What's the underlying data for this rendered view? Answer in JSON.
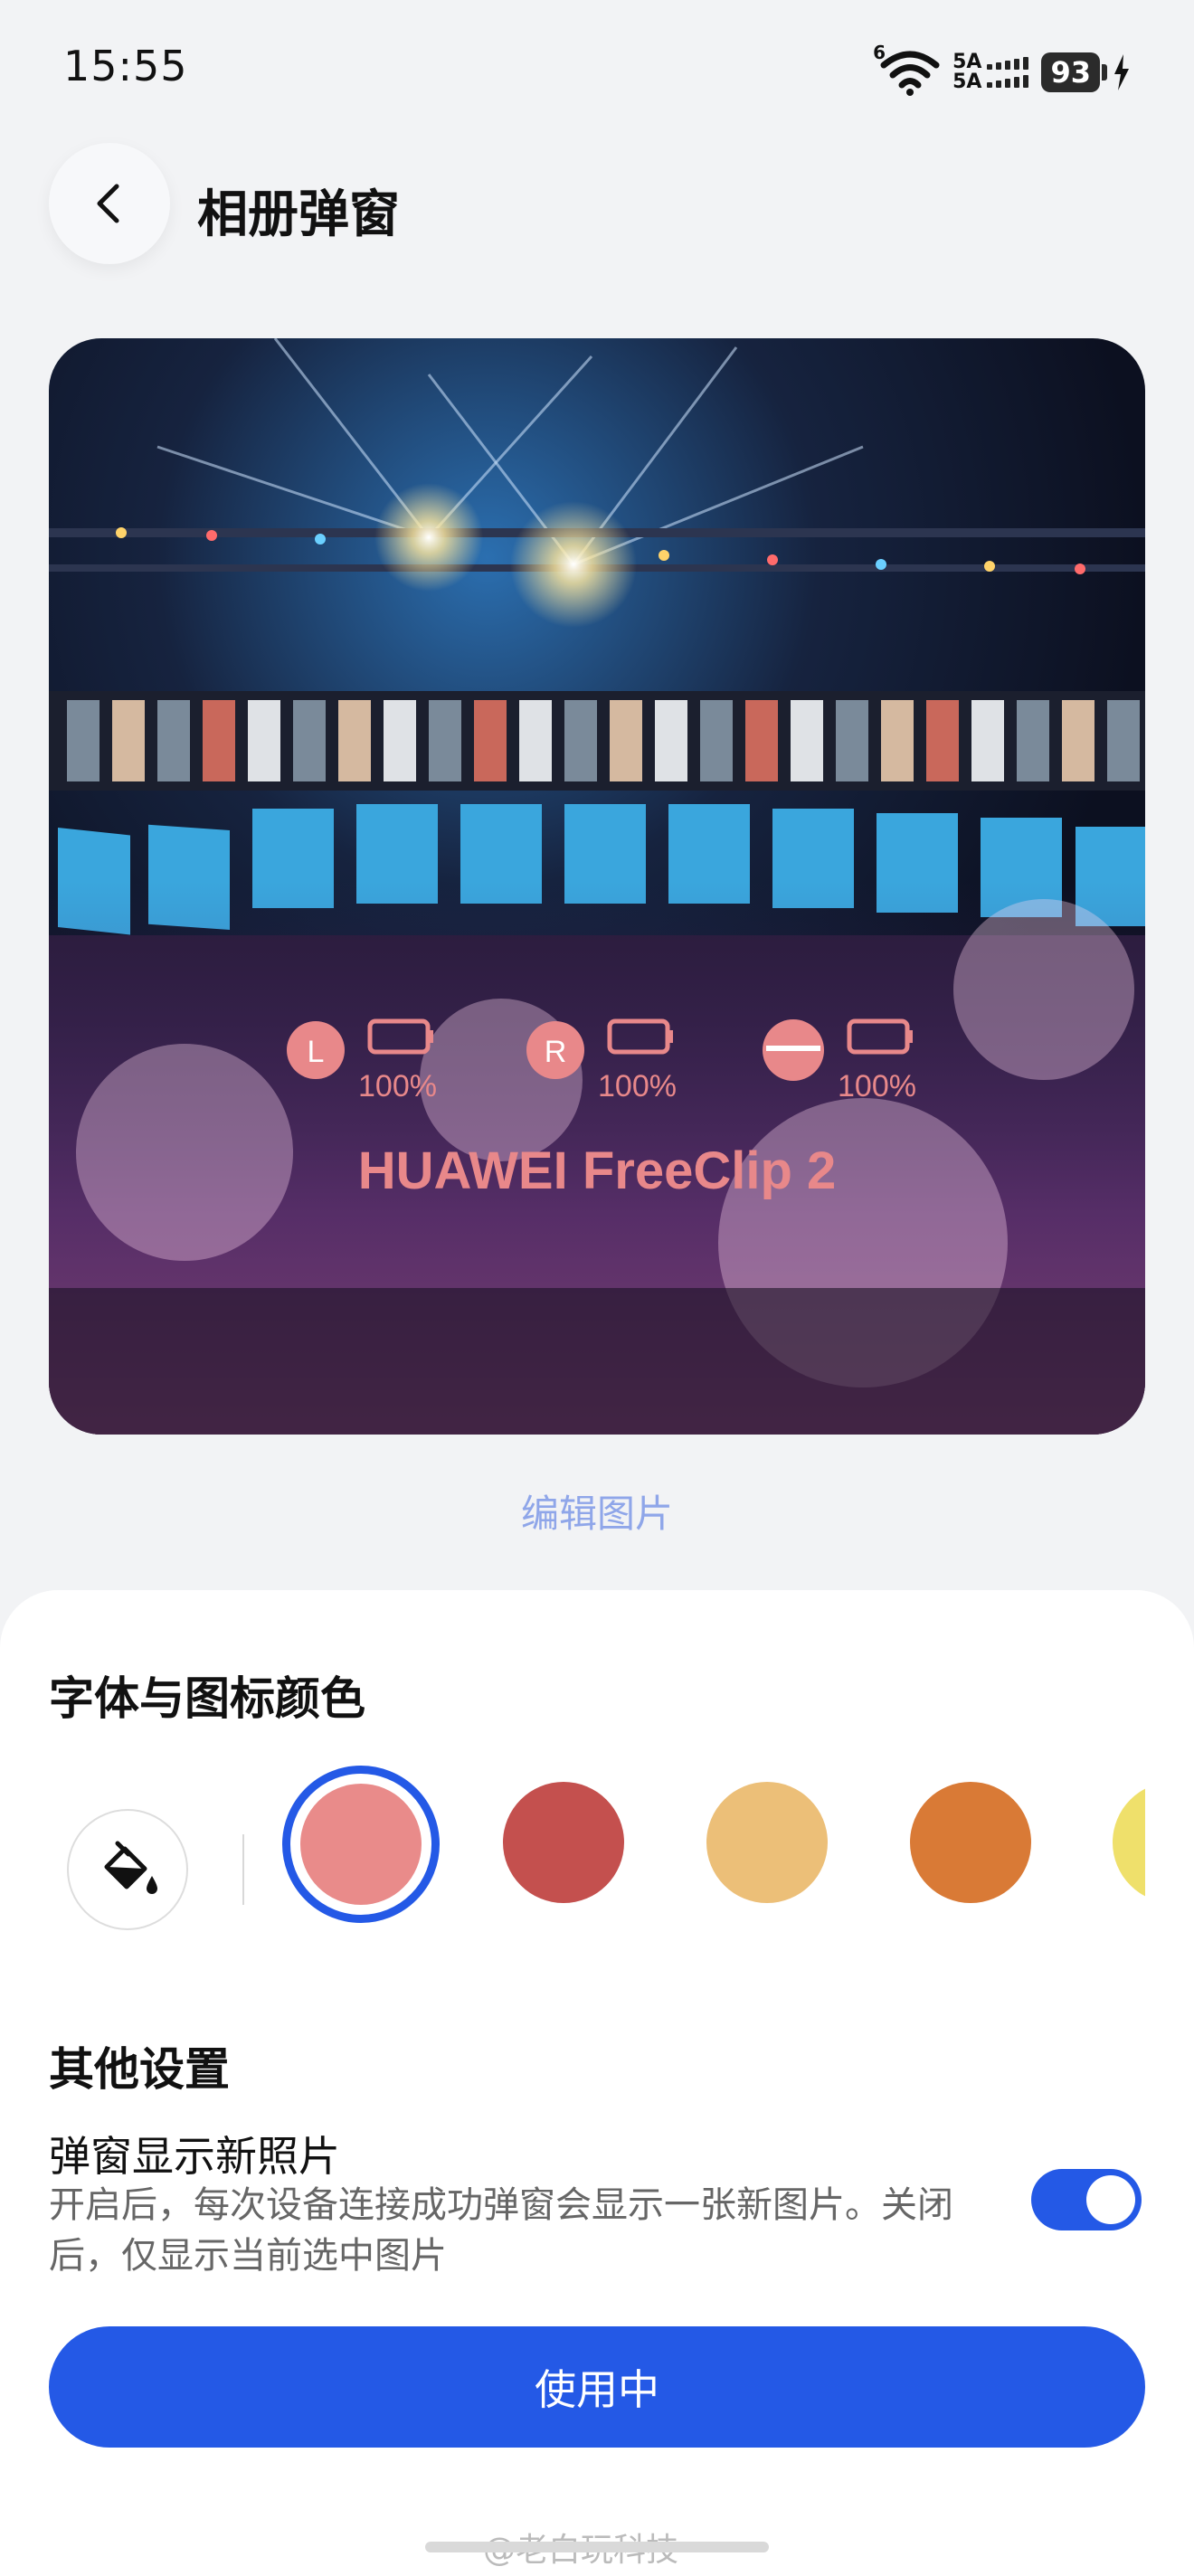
{
  "status_bar": {
    "time": "15:55",
    "wifi_badge": "6",
    "signal_labels": [
      "5A",
      "5A"
    ],
    "battery": "93"
  },
  "header": {
    "title": "相册弹窗"
  },
  "preview": {
    "left_label": "L",
    "left_battery": "100%",
    "right_label": "R",
    "right_battery": "100%",
    "case_battery": "100%",
    "product_name": "HUAWEI FreeClip 2",
    "overlay_color": "#e8888a"
  },
  "edit_link": "编辑图片",
  "color_section": {
    "title": "字体与图标颜色",
    "swatches": [
      {
        "color": "#e98b8a",
        "selected": true
      },
      {
        "color": "#c4504e",
        "selected": false
      },
      {
        "color": "#ecbf78",
        "selected": false
      },
      {
        "color": "#d97a36",
        "selected": false
      },
      {
        "color": "#efe06b",
        "selected": false
      }
    ],
    "accent": "#2459e6"
  },
  "other_section": {
    "title": "其他设置",
    "setting_title": "弹窗显示新照片",
    "setting_desc": "开启后，每次设备连接成功弹窗会显示一张新图片。关闭后，仅显示当前选中图片",
    "toggle_on": true
  },
  "use_button": "使用中",
  "watermark": "@老白玩科技"
}
